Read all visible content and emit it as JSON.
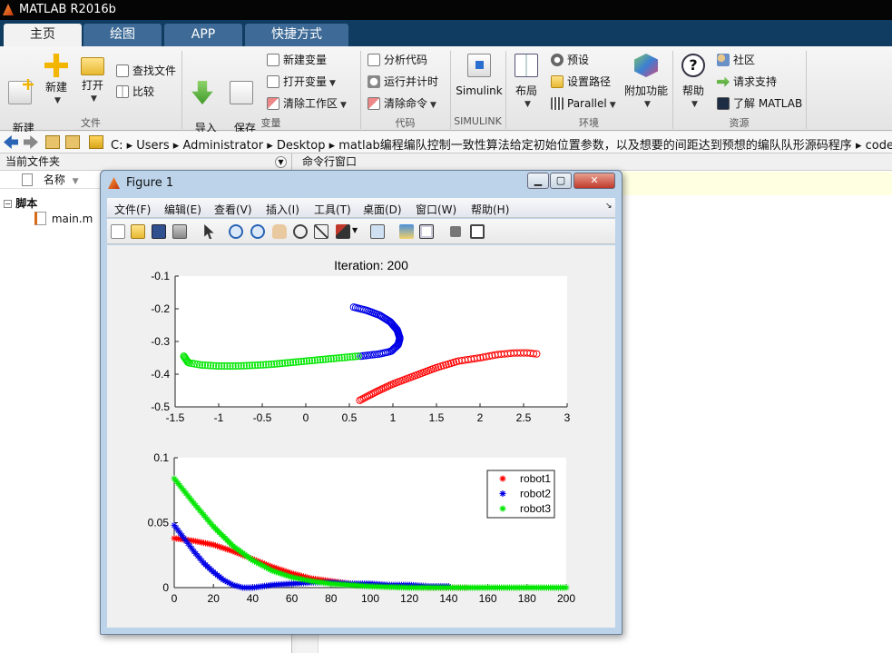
{
  "app": {
    "title": "MATLAB R2016b"
  },
  "tabs": [
    {
      "label": "主页"
    },
    {
      "label": "绘图"
    },
    {
      "label": "APP"
    },
    {
      "label": "快捷方式"
    }
  ],
  "ribbon": {
    "new_script": "新建\n脚本",
    "new": "新建",
    "open": "打开",
    "find_files": "查找文件",
    "compare": "比较",
    "import_data": "导入\n数据",
    "save_workspace": "保存\n工作区",
    "new_variable": "新建变量",
    "open_variable": "打开变量",
    "clear_workspace": "清除工作区",
    "analyze_code": "分析代码",
    "run_and_time": "运行并计时",
    "clear_commands": "清除命令",
    "simulink": "Simulink",
    "layout": "布局",
    "preferences": "预设",
    "set_path": "设置路径",
    "parallel": "Parallel",
    "addons": "附加功能",
    "help": "帮助",
    "community": "社区",
    "request_support": "请求支持",
    "learn_matlab": "了解 MATLAB",
    "groups": {
      "file": "文件",
      "variable": "变量",
      "code": "代码",
      "simulink": "SIMULINK",
      "environment": "环境",
      "resources": "资源"
    }
  },
  "address": {
    "path": "C:  ▸  Users  ▸  Administrator  ▸  Desktop  ▸  matlab编程编队控制一致性算法给定初始位置参数，以及想要的间距达到预想的编队队形源码程序  ▸  code"
  },
  "current_folder": {
    "header": "当前文件夹",
    "col_name": "名称",
    "section": "脚本",
    "files": [
      "main.m"
    ]
  },
  "command_window": {
    "header": "命令行窗口"
  },
  "figure": {
    "title": "Figure 1",
    "menus": [
      "文件(F)",
      "编辑(E)",
      "查看(V)",
      "插入(I)",
      "工具(T)",
      "桌面(D)",
      "窗口(W)",
      "帮助(H)"
    ],
    "plot1": {
      "title": "Iteration: 200",
      "xticks": [
        "-1.5",
        "-1",
        "-0.5",
        "0",
        "0.5",
        "1",
        "1.5",
        "2",
        "2.5",
        "3"
      ],
      "yticks": [
        "-0.1",
        "-0.2",
        "-0.3",
        "-0.4",
        "-0.5"
      ]
    },
    "plot2": {
      "xticks": [
        "0",
        "20",
        "40",
        "60",
        "80",
        "100",
        "120",
        "140",
        "160",
        "180",
        "200"
      ],
      "yticks": [
        "0.1",
        "0.05",
        "0"
      ],
      "legend": [
        "robot1",
        "robot2",
        "robot3"
      ]
    }
  },
  "colors": {
    "robot1": "#ff0000",
    "robot2": "#0000e6",
    "robot3": "#00e600"
  },
  "chart_data": [
    {
      "type": "scatter",
      "title": "Iteration: 200",
      "xlim": [
        -1.5,
        3
      ],
      "ylim": [
        -0.5,
        -0.1
      ],
      "series": [
        {
          "x": [
            0.62,
            0.8,
            1.0,
            1.25,
            1.5,
            1.75,
            2.0,
            2.2,
            2.4,
            2.55,
            2.65
          ],
          "y": [
            -0.48,
            -0.455,
            -0.43,
            -0.405,
            -0.38,
            -0.36,
            -0.35,
            -0.34,
            -0.335,
            -0.335,
            -0.338
          ]
        },
        {
          "x": [
            0.55,
            0.7,
            0.85,
            0.97,
            1.05,
            1.08,
            1.06,
            0.98,
            0.85,
            0.72,
            0.63
          ],
          "y": [
            -0.195,
            -0.205,
            -0.22,
            -0.24,
            -0.265,
            -0.29,
            -0.31,
            -0.33,
            -0.338,
            -0.342,
            -0.345
          ]
        },
        {
          "x": [
            -1.4,
            -1.35,
            -1.2,
            -1.0,
            -0.8,
            -0.6,
            -0.4,
            -0.2,
            0.0,
            0.2,
            0.4,
            0.6
          ],
          "y": [
            -0.345,
            -0.365,
            -0.372,
            -0.375,
            -0.375,
            -0.373,
            -0.37,
            -0.365,
            -0.36,
            -0.355,
            -0.35,
            -0.345
          ]
        }
      ]
    },
    {
      "type": "line",
      "xlim": [
        0,
        200
      ],
      "ylim": [
        0,
        0.1
      ],
      "series": [
        {
          "name": "robot1",
          "x": [
            0,
            10,
            20,
            30,
            40,
            50,
            60,
            70,
            80,
            90,
            100,
            110,
            120,
            130,
            140,
            150
          ],
          "y": [
            0.038,
            0.036,
            0.033,
            0.028,
            0.022,
            0.016,
            0.011,
            0.007,
            0.005,
            0.003,
            0.002,
            0.001,
            0.001,
            0.0,
            0.0,
            0.0
          ]
        },
        {
          "name": "robot2",
          "x": [
            0,
            5,
            10,
            15,
            20,
            25,
            30,
            35,
            40,
            50,
            60,
            70,
            80,
            90,
            100,
            110,
            120,
            130,
            140
          ],
          "y": [
            0.048,
            0.038,
            0.028,
            0.019,
            0.012,
            0.006,
            0.002,
            0.0,
            0.0,
            0.002,
            0.003,
            0.004,
            0.004,
            0.003,
            0.003,
            0.002,
            0.002,
            0.001,
            0.001
          ]
        },
        {
          "name": "robot3",
          "x": [
            0,
            10,
            20,
            30,
            40,
            50,
            60,
            70,
            80,
            90,
            100,
            120,
            140,
            160,
            180,
            200
          ],
          "y": [
            0.084,
            0.065,
            0.047,
            0.032,
            0.021,
            0.013,
            0.008,
            0.005,
            0.003,
            0.002,
            0.001,
            0.0,
            0.0,
            0.0,
            0.0,
            0.0
          ]
        }
      ]
    }
  ]
}
